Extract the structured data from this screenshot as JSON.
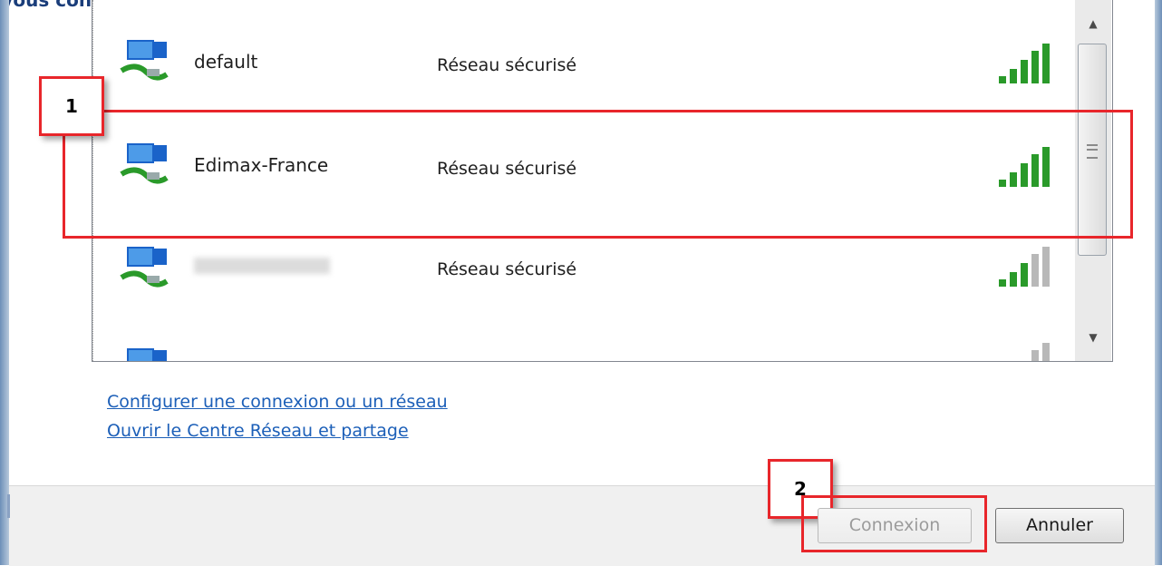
{
  "header": {
    "partial_text": "Vous connectez au réseau en cliquant sur « Connexion »."
  },
  "networks": [
    {
      "name": "default",
      "status": "Réseau sécurisé",
      "signal_bars": 5
    },
    {
      "name": "Edimax-France",
      "status": "Réseau sécurisé",
      "signal_bars": 5
    },
    {
      "name": "",
      "status": "Réseau sécurisé",
      "signal_bars": 3
    },
    {
      "name": "",
      "status": "",
      "signal_bars": 1
    }
  ],
  "links": {
    "setup": "Configurer une connexion ou un réseau",
    "network_center": "Ouvrir le Centre Réseau et partage"
  },
  "buttons": {
    "connect": "Connexion",
    "cancel": "Annuler"
  },
  "callouts": {
    "one": "1",
    "two": "2"
  },
  "colors": {
    "accent_red": "#e8262b",
    "link_blue": "#1c5fb8",
    "signal_green": "#2a9a2a",
    "signal_gray": "#b8b8b8"
  },
  "icons": {
    "network": "network-computer-icon",
    "signal": "signal-strength-icon"
  }
}
